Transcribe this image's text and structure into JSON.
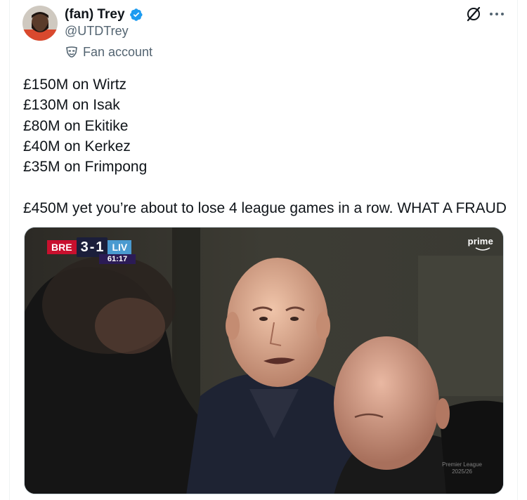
{
  "author": {
    "display_name": "(fan) Trey",
    "handle": "@UTDTrey",
    "affiliation_label": "Fan account",
    "verified_icon": "verified-badge-icon",
    "verified_color": "#1d9bf0"
  },
  "tweet": {
    "lines": [
      "£150M on Wirtz",
      "£130M on Isak",
      "£80M on Ekitike",
      "£40M on Kerkez",
      "£35M on Frimpong"
    ],
    "closing": "£450M yet you’re about to lose 4 league games in a row. WHAT A FRAUD"
  },
  "media": {
    "scorebug": {
      "home": "BRE",
      "score": "3-1",
      "score_home": "3",
      "score_away": "1",
      "away": "LIV",
      "clock": "61:17"
    },
    "broadcaster": "prime",
    "watermark_line1": "Premier League",
    "watermark_line2": "2025/26"
  },
  "icons": {
    "grok": "grok-icon",
    "more": "more-icon"
  },
  "colors": {
    "text_primary": "#0f1419",
    "text_secondary": "#536471",
    "border": "#cfd9de",
    "accent": "#1d9bf0"
  }
}
